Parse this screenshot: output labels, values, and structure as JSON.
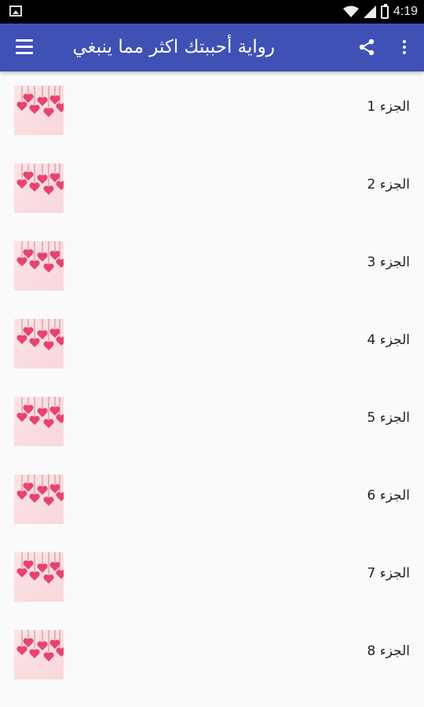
{
  "status_bar": {
    "time": "4:19"
  },
  "app_bar": {
    "title": "رواية أحببتك اكثر مما ينبغي",
    "menu_icon": "menu-icon",
    "share_icon": "share-icon",
    "more_icon": "more-vert-icon"
  },
  "parts": [
    {
      "label": "الجزء 1"
    },
    {
      "label": "الجزء 2"
    },
    {
      "label": "الجزء 3"
    },
    {
      "label": "الجزء 4"
    },
    {
      "label": "الجزء 5"
    },
    {
      "label": "الجزء 6"
    },
    {
      "label": "الجزء 7"
    },
    {
      "label": "الجزء 8"
    }
  ],
  "colors": {
    "app_bar": "#3f51b5",
    "status_bar": "#000000",
    "background": "#fafafa",
    "heart": "#e8436e"
  }
}
